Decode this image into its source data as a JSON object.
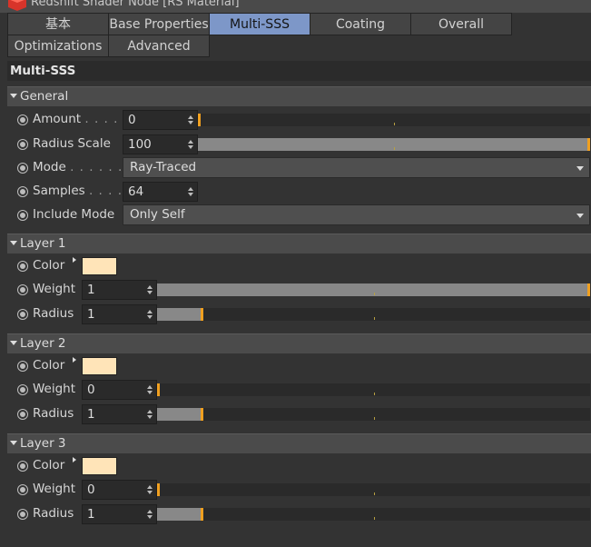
{
  "window": {
    "title": "Redshift Shader Node [RS Material]"
  },
  "tabs": [
    {
      "label": "基本",
      "active": false
    },
    {
      "label": "Base Properties",
      "active": false
    },
    {
      "label": "Multi-SSS",
      "active": true
    },
    {
      "label": "Coating",
      "active": false
    },
    {
      "label": "Overall",
      "active": false
    },
    {
      "label": "Optimizations",
      "active": false
    },
    {
      "label": "Advanced",
      "active": false
    }
  ],
  "section": {
    "title": "Multi-SSS"
  },
  "general": {
    "title": "General",
    "amount": {
      "label": "Amount",
      "dots": ". . . . .",
      "value": "0",
      "fraction": 0
    },
    "radius_scale": {
      "label": "Radius Scale",
      "value": "100",
      "fraction": 1
    },
    "mode": {
      "label": "Mode",
      "dots": ". . . . . . .",
      "value": "Ray-Traced"
    },
    "samples": {
      "label": "Samples",
      "dots": ". . . . .",
      "value": "64"
    },
    "include_mode": {
      "label": "Include Mode",
      "value": "Only Self"
    }
  },
  "layers": [
    {
      "title": "Layer 1",
      "color_label": "Color",
      "color": "#ffe4b8",
      "weight": {
        "label": "Weight",
        "value": "1",
        "fraction": 1
      },
      "radius": {
        "label": "Radius",
        "value": "1",
        "fraction": 0.1
      }
    },
    {
      "title": "Layer 2",
      "color_label": "Color",
      "color": "#ffe4b8",
      "weight": {
        "label": "Weight",
        "value": "0",
        "fraction": 0
      },
      "radius": {
        "label": "Radius",
        "value": "1",
        "fraction": 0.1
      }
    },
    {
      "title": "Layer 3",
      "color_label": "Color",
      "color": "#ffe4b8",
      "weight": {
        "label": "Weight",
        "value": "0",
        "fraction": 0
      },
      "radius": {
        "label": "Radius",
        "value": "1",
        "fraction": 0.1
      }
    }
  ],
  "colors": {
    "accent": "#f0a020",
    "active_tab": "#7d97c8",
    "logo": "#d8342a"
  }
}
